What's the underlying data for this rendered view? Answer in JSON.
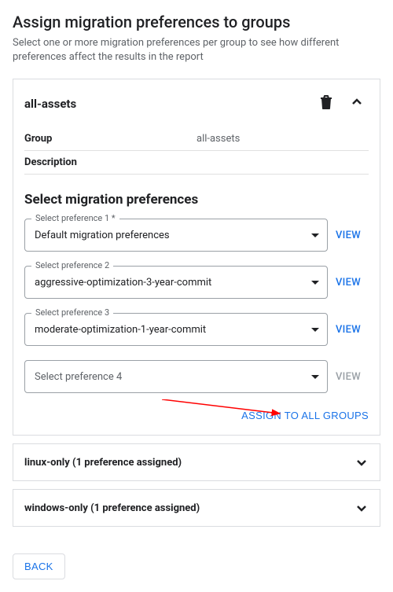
{
  "page": {
    "title": "Assign migration preferences to groups",
    "subtitle": "Select one or more migration preferences per group to see how different preferences affect the results in the report"
  },
  "expanded": {
    "title": "all-assets",
    "details": {
      "group_label": "Group",
      "group_value": "all-assets",
      "desc_label": "Description",
      "desc_value": ""
    },
    "section_title": "Select migration preferences",
    "prefs": [
      {
        "label": "Select preference 1 *",
        "value": "Default migration preferences"
      },
      {
        "label": "Select preference 2",
        "value": "aggressive-optimization-3-year-commit"
      },
      {
        "label": "Select preference 3",
        "value": "moderate-optimization-1-year-commit"
      }
    ],
    "pref4_placeholder": "Select preference 4",
    "view_label": "VIEW",
    "assign_label": "ASSIGN TO ALL GROUPS"
  },
  "collapsed": [
    {
      "title": "linux-only (1 preference assigned)"
    },
    {
      "title": "windows-only (1 preference assigned)"
    }
  ],
  "back_label": "BACK"
}
